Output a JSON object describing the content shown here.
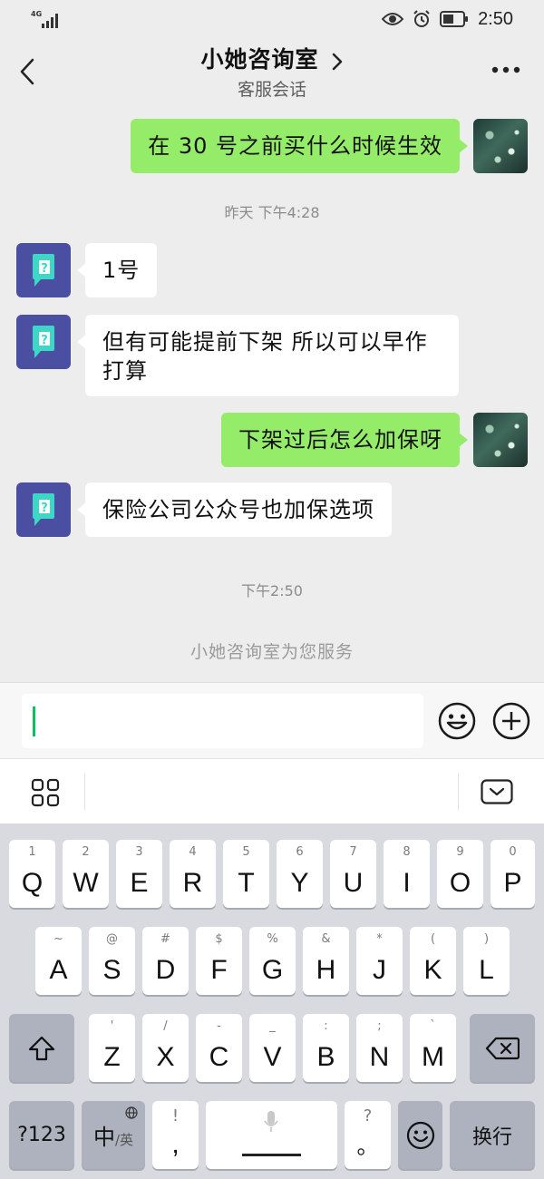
{
  "status_bar": {
    "network": "4G",
    "time": "2:50"
  },
  "header": {
    "title": "小她咨询室",
    "subtitle": "客服会话"
  },
  "messages": [
    {
      "side": "right",
      "text": "在 30 号之前买什么时候生效"
    },
    {
      "side": "left",
      "text": "1号"
    },
    {
      "side": "left",
      "line1": "但有可能提前下架 所以可以早作",
      "line2": "打算"
    },
    {
      "side": "right",
      "text": "下架过后怎么加保呀"
    },
    {
      "side": "left",
      "text": "保险公司公众号也加保选项"
    }
  ],
  "timestamps": {
    "first": "昨天 下午4:28",
    "second": "下午2:50"
  },
  "service_note": "小她咨询室为您服务",
  "input": {
    "value": ""
  },
  "keyboard": {
    "row1": [
      {
        "hint": "1",
        "key": "Q"
      },
      {
        "hint": "2",
        "key": "W"
      },
      {
        "hint": "3",
        "key": "E"
      },
      {
        "hint": "4",
        "key": "R"
      },
      {
        "hint": "5",
        "key": "T"
      },
      {
        "hint": "6",
        "key": "Y"
      },
      {
        "hint": "7",
        "key": "U"
      },
      {
        "hint": "8",
        "key": "I"
      },
      {
        "hint": "9",
        "key": "O"
      },
      {
        "hint": "0",
        "key": "P"
      }
    ],
    "row2": [
      {
        "hint": "~",
        "key": "A"
      },
      {
        "hint": "@",
        "key": "S"
      },
      {
        "hint": "#",
        "key": "D"
      },
      {
        "hint": "$",
        "key": "F"
      },
      {
        "hint": "%",
        "key": "G"
      },
      {
        "hint": "&",
        "key": "H"
      },
      {
        "hint": "*",
        "key": "J"
      },
      {
        "hint": "(",
        "key": "K"
      },
      {
        "hint": ")",
        "key": "L"
      }
    ],
    "row3": [
      {
        "hint": "'",
        "key": "Z"
      },
      {
        "hint": "/",
        "key": "X"
      },
      {
        "hint": "-",
        "key": "C"
      },
      {
        "hint": "_",
        "key": "V"
      },
      {
        "hint": ":",
        "key": "B"
      },
      {
        "hint": ";",
        "key": "N"
      },
      {
        "hint": "`",
        "key": "M"
      }
    ],
    "bottom": {
      "symbols": "?123",
      "lang_main": "中",
      "lang_alt": "/英",
      "punct_hint": "!",
      "punct_key": ",",
      "q_hint": "?",
      "q_key": "。",
      "enter": "换行"
    }
  },
  "icons": {
    "status": [
      "signal-icon",
      "eye-icon",
      "alarm-icon",
      "battery-icon"
    ],
    "header": [
      "back-arrow-icon",
      "chevron-right-icon",
      "more-icon"
    ],
    "input": [
      "emoji-icon",
      "plus-icon"
    ],
    "toolbar": [
      "grid-icon",
      "keyboard-collapse-icon"
    ],
    "keyboard": [
      "shift-icon",
      "backspace-icon",
      "globe-icon",
      "microphone-icon",
      "emoji-icon"
    ]
  },
  "colors": {
    "background": "#ededed",
    "sent_bubble": "#95ec69",
    "received_bubble": "#ffffff",
    "bot_avatar": "#4b4fa1",
    "accent": "#07c160"
  }
}
